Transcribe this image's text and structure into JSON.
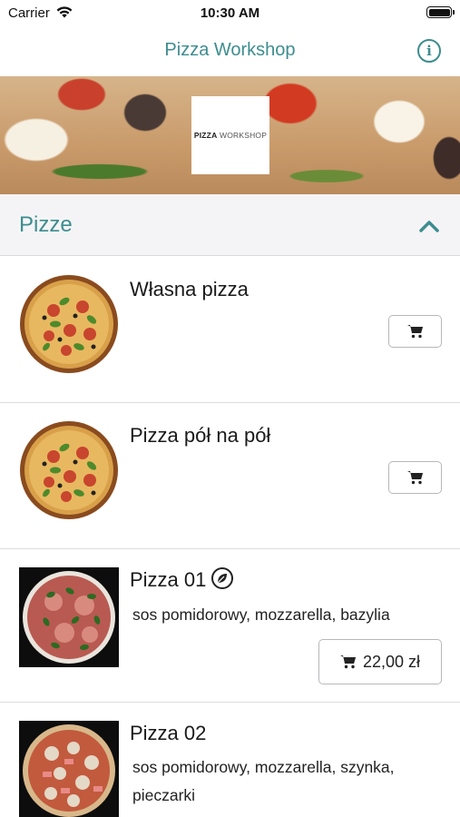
{
  "status_bar": {
    "carrier": "Carrier",
    "time": "10:30 AM"
  },
  "nav": {
    "title": "Pizza Workshop",
    "info_icon": "info-circle-icon"
  },
  "banner": {
    "logo_bold": "PIZZA",
    "logo_light": " WORKSHOP"
  },
  "section": {
    "title": "Pizze",
    "expanded": true
  },
  "products": [
    {
      "name": "Własna pizza",
      "description": "",
      "price": ""
    },
    {
      "name": "Pizza pół na pół",
      "description": "",
      "price": ""
    },
    {
      "name": "Pizza 01",
      "description": "sos pomidorowy, mozzarella, bazylia",
      "price": "22,00 zł",
      "vegetarian": true
    },
    {
      "name": "Pizza 02",
      "description": "sos pomidorowy, mozzarella, szynka, pieczarki",
      "price": ""
    }
  ],
  "colors": {
    "accent": "#3d8d8f",
    "section_bg": "#f4f4f6"
  }
}
